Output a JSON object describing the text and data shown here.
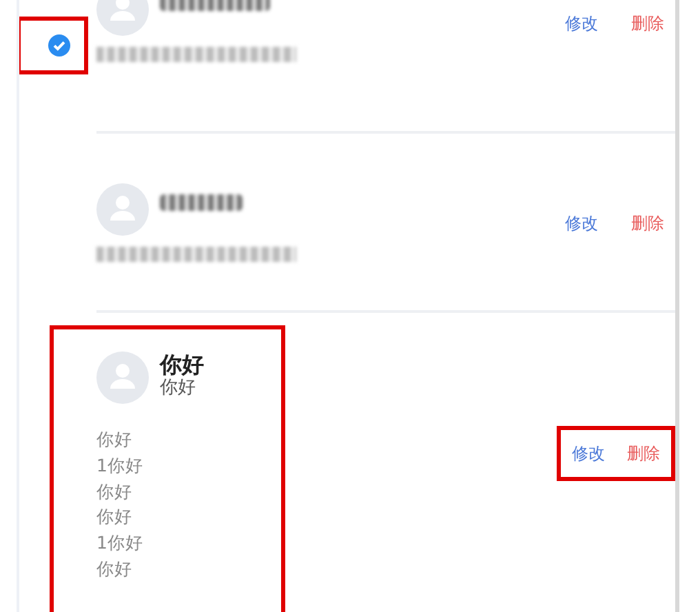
{
  "contacts": [
    {
      "masked": true,
      "checked": true,
      "actions": [
        {
          "label": "修改",
          "kind": "edit"
        },
        {
          "label": "删除",
          "kind": "delete"
        }
      ]
    },
    {
      "masked": true,
      "actions": [
        {
          "label": "修改",
          "kind": "edit"
        },
        {
          "label": "删除",
          "kind": "delete"
        }
      ]
    },
    {
      "masked": false,
      "name": "你好",
      "subtitle": "你好",
      "notes": [
        "你好",
        "1你好",
        "你好",
        "你好",
        "1你好",
        "你好"
      ],
      "highlight_body": true,
      "highlight_actions": true,
      "actions": [
        {
          "label": "修改",
          "kind": "edit"
        },
        {
          "label": "删除",
          "kind": "delete"
        }
      ]
    }
  ]
}
